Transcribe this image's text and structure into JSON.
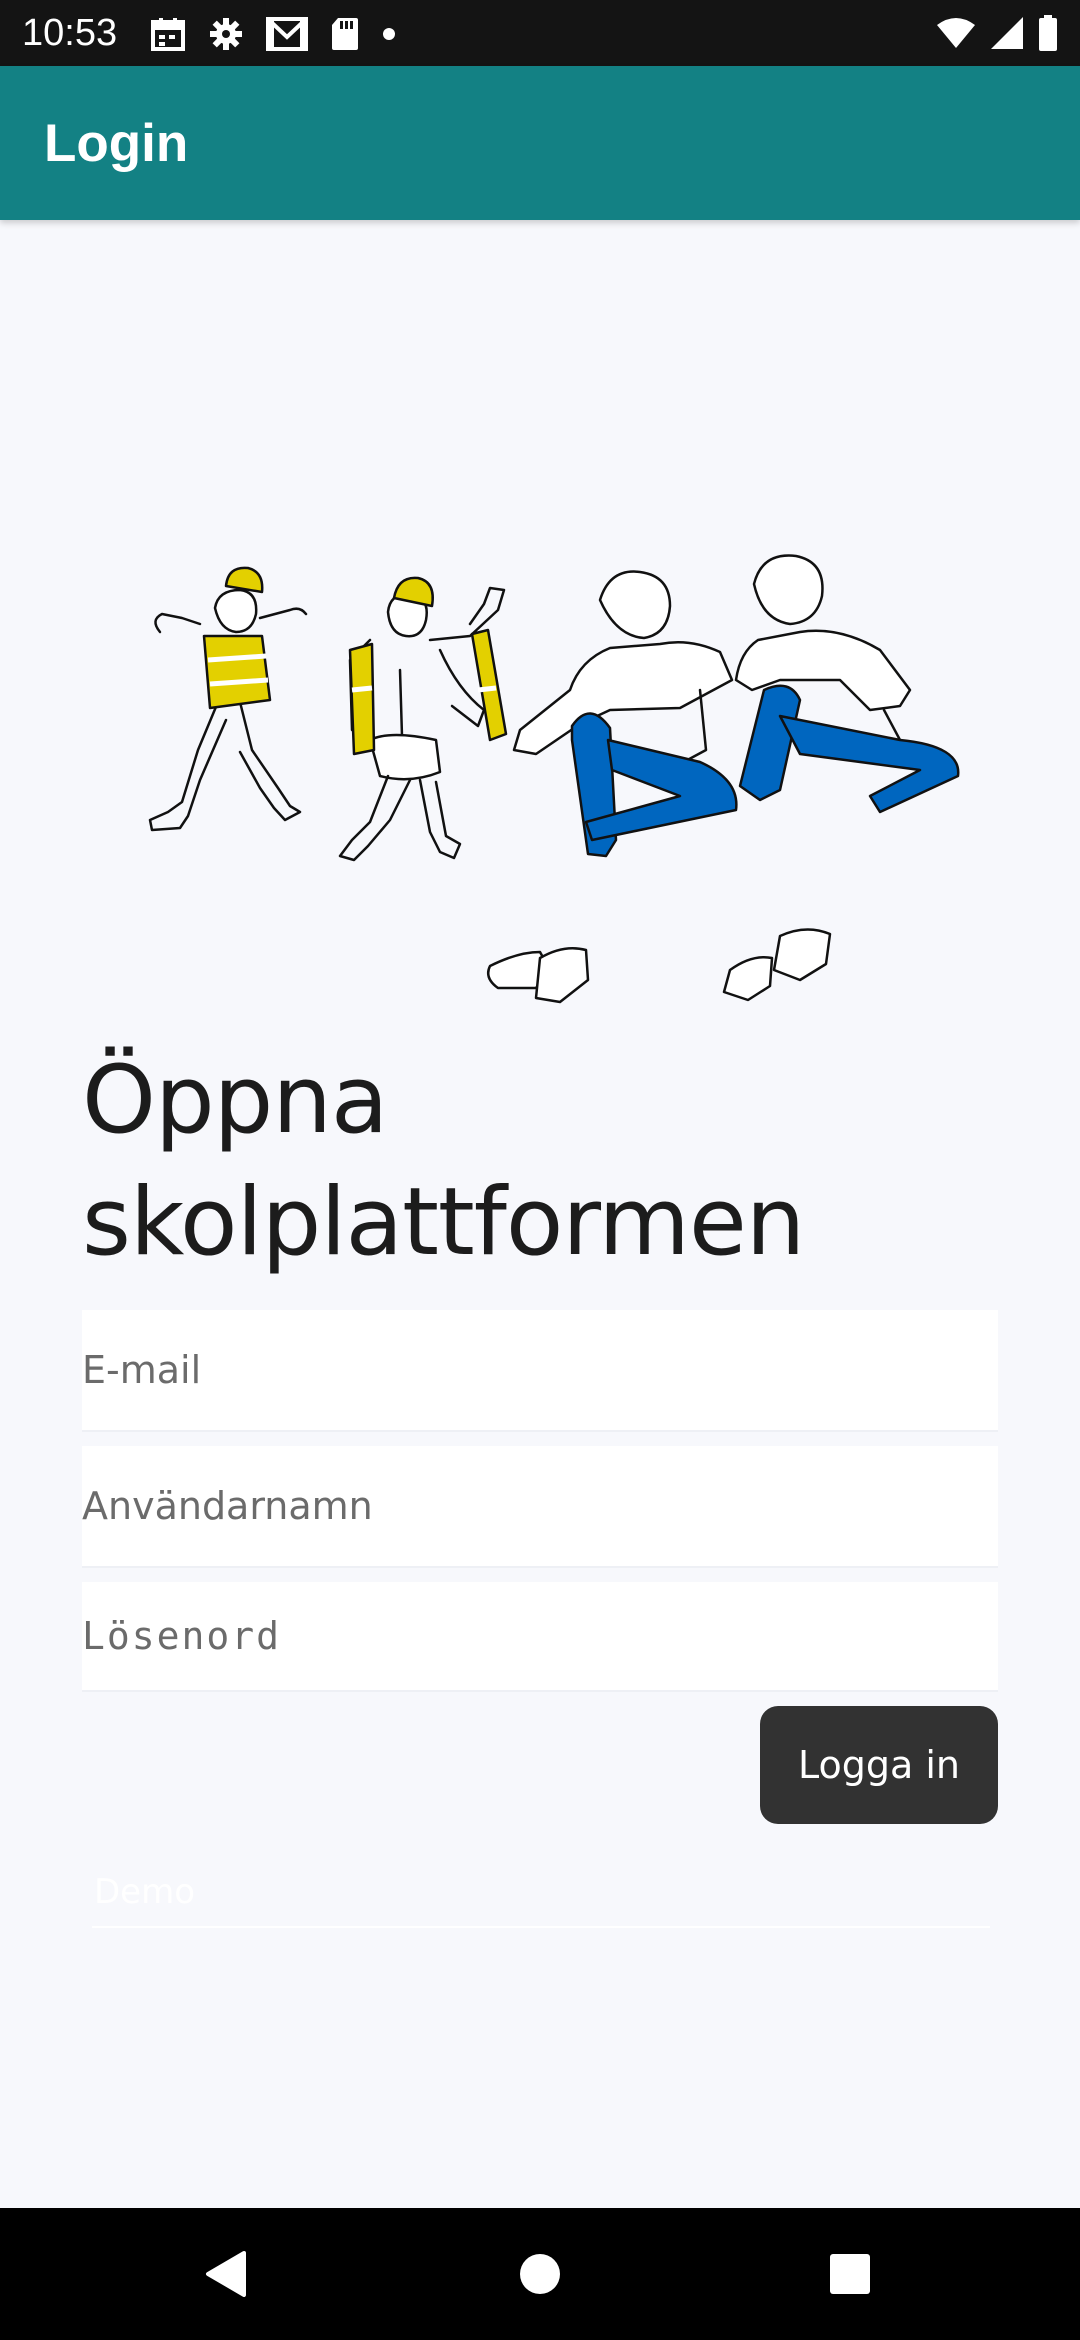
{
  "status_bar": {
    "time": "10:53",
    "left_icons": [
      "calendar-icon",
      "gear-icon",
      "gmail-icon",
      "sd-card-icon",
      "dot-icon"
    ],
    "right_icons": [
      "wifi-icon",
      "signal-icon",
      "battery-icon"
    ]
  },
  "app_bar": {
    "title": "Login"
  },
  "main": {
    "heading": "Öppna skolplattformen",
    "email_placeholder": "E-mail",
    "username_placeholder": "Användarnamn",
    "password_placeholder": "Lösenord",
    "login_label": "Logga in",
    "demo_label": "Demo"
  },
  "colors": {
    "app_bar": "#138184",
    "button": "#323232",
    "background": "#f7f8fc",
    "jeans_blue": "#0066bf",
    "vest_yellow": "#e3d000"
  },
  "nav_bar": {
    "buttons": [
      "back-icon",
      "home-icon",
      "recents-icon"
    ]
  }
}
